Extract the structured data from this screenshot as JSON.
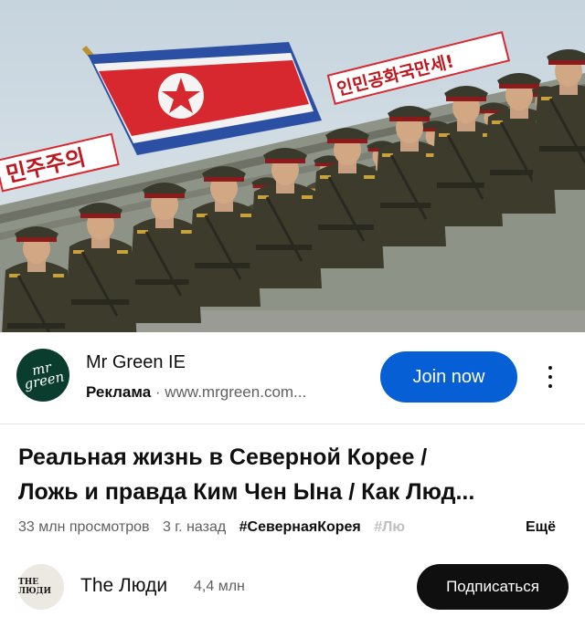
{
  "thumbnail": {
    "sign_left": "민주주의",
    "sign_right": "인민공화국만세!"
  },
  "ad": {
    "logo_text": "mr green",
    "advertiser": "Mr Green IE",
    "label": "Реклама",
    "separator": "·",
    "url": "www.mrgreen.com...",
    "cta": "Join now",
    "more_icon": "more-vertical-icon"
  },
  "video": {
    "title_line1": "Реальная жизнь в Северной Корее /",
    "title_line2": "Ложь и правда  Ким Чен Ына / Как Люд...",
    "views": "33 млн просмотров",
    "age": "3 г. назад",
    "hashtag1": "#СевернаяКорея",
    "hashtag2": "#Лю",
    "more": "Ещё"
  },
  "channel": {
    "avatar_text": "THE ЛЮДИ",
    "name": "The Люди",
    "subscribers": "4,4 млн",
    "subscribe": "Подписаться"
  },
  "colors": {
    "accent": "#065fd4",
    "flag_red": "#d7282f",
    "uniform": "#3d3b2c"
  }
}
